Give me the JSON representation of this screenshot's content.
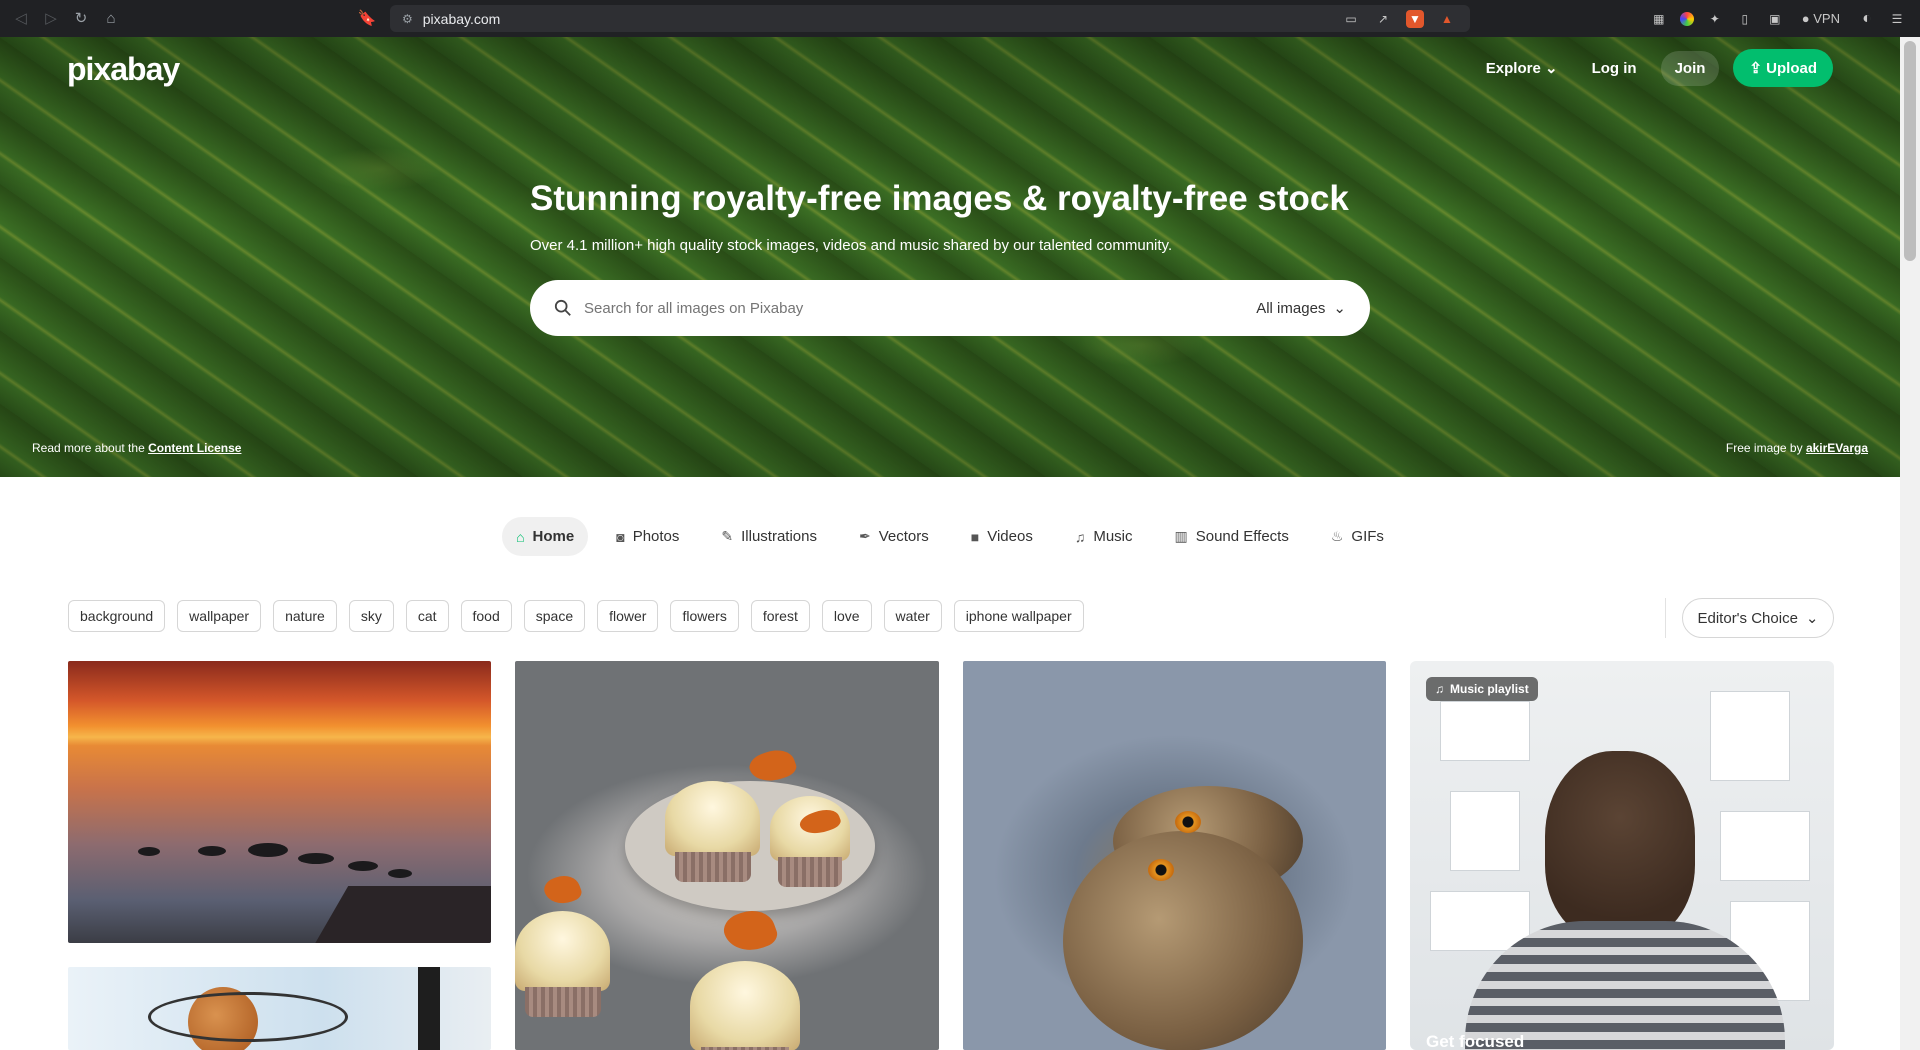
{
  "browser": {
    "url": "pixabay.com",
    "vpn_label": "VPN"
  },
  "site": {
    "logo": "pixabay",
    "nav": {
      "explore": "Explore",
      "login": "Log in",
      "join": "Join",
      "upload": "Upload"
    }
  },
  "hero": {
    "title": "Stunning royalty-free images & royalty-free stock",
    "subtitle": "Over 4.1 million+ high quality stock images, videos and music shared by our talented community.",
    "search_placeholder": "Search for all images on Pixabay",
    "search_filter": "All images",
    "license_prefix": "Read more about the ",
    "license_link": "Content License",
    "credit_prefix": "Free image by ",
    "credit_author": "akirEVarga"
  },
  "tabs": [
    {
      "label": "Home",
      "icon": "home-icon",
      "active": true
    },
    {
      "label": "Photos",
      "icon": "camera-icon"
    },
    {
      "label": "Illustrations",
      "icon": "brush-icon"
    },
    {
      "label": "Vectors",
      "icon": "pen-nib-icon"
    },
    {
      "label": "Videos",
      "icon": "video-icon"
    },
    {
      "label": "Music",
      "icon": "music-note-icon"
    },
    {
      "label": "Sound Effects",
      "icon": "waveform-icon"
    },
    {
      "label": "GIFs",
      "icon": "flame-icon"
    }
  ],
  "tags": [
    "background",
    "wallpaper",
    "nature",
    "sky",
    "cat",
    "food",
    "space",
    "flower",
    "flowers",
    "forest",
    "love",
    "water",
    "iphone wallpaper"
  ],
  "sort": {
    "label": "Editor's Choice"
  },
  "gallery": {
    "music_card": {
      "badge": "Music playlist",
      "caption": "Get focused"
    }
  },
  "colors": {
    "accent": "#02be6e"
  }
}
